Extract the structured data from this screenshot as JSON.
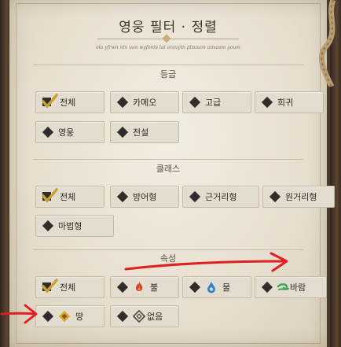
{
  "panel": {
    "title": "영웅 필터 · 정렬",
    "flavor": "ola yfrwn ntv uan wyfonts lat oravytn plsuuon uoxaam youm"
  },
  "sections": {
    "grade": {
      "title": "등급",
      "options": [
        "전체",
        "카메오",
        "고급",
        "희귀",
        "영웅",
        "전설"
      ]
    },
    "class": {
      "title": "클래스",
      "options": [
        "전체",
        "방어형",
        "근거리형",
        "원거리형",
        "마법형"
      ]
    },
    "element": {
      "title": "속성",
      "options": [
        "전체",
        "불",
        "물",
        "바람",
        "땅",
        "없음"
      ]
    }
  },
  "selected": {
    "grade": "전체",
    "class": "전체",
    "element": "전체"
  },
  "colors": {
    "parchment": "#ece6d8",
    "check_gold": "#c9a233",
    "fire": "#d9412a",
    "water": "#3a7fc0",
    "wind": "#3aa655",
    "earth": "#d9a52c",
    "annotation_red": "#e02020"
  },
  "icons": {
    "selected": "gold-check-icon",
    "unselected": "black-diamond-icon",
    "fire": "flame-icon",
    "water": "droplet-icon",
    "wind": "wind-swirl-icon",
    "earth": "earth-rune-icon",
    "none": "void-diamond-icon"
  }
}
